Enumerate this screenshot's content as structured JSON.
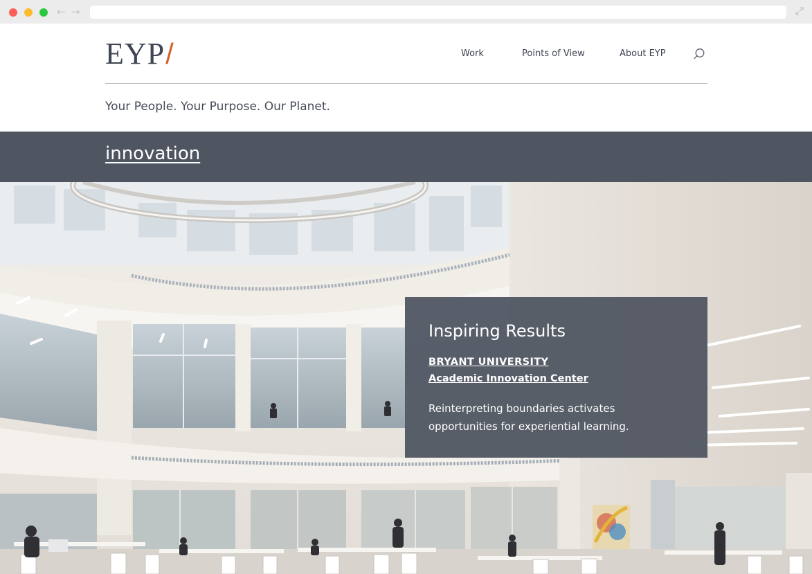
{
  "browser": {
    "back_icon": "arrow-left-icon",
    "forward_icon": "arrow-right-icon",
    "expand_icon": "expand-icon",
    "traffic_colors": [
      "#fc5f57",
      "#fdbc2e",
      "#29c840"
    ]
  },
  "header": {
    "logo": "EYP",
    "logo_slash": "/",
    "nav": [
      {
        "label": "Work"
      },
      {
        "label": "Points of View"
      },
      {
        "label": "About EYP"
      }
    ],
    "search_icon": "search-icon",
    "tagline": "Your People. Your Purpose. Our Planet."
  },
  "section": {
    "title": "innovation"
  },
  "hero": {
    "image": "atrium-interior-photo"
  },
  "feature": {
    "heading": "Inspiring Results",
    "link_line1": "BRYANT UNIVERSITY",
    "link_line2": "Academic Innovation Center",
    "description": "Reinterpreting boundaries activates opportunities for experiential learning."
  },
  "colors": {
    "accent": "#d2622c",
    "bar": "#4f5561",
    "text": "#3e4452"
  }
}
